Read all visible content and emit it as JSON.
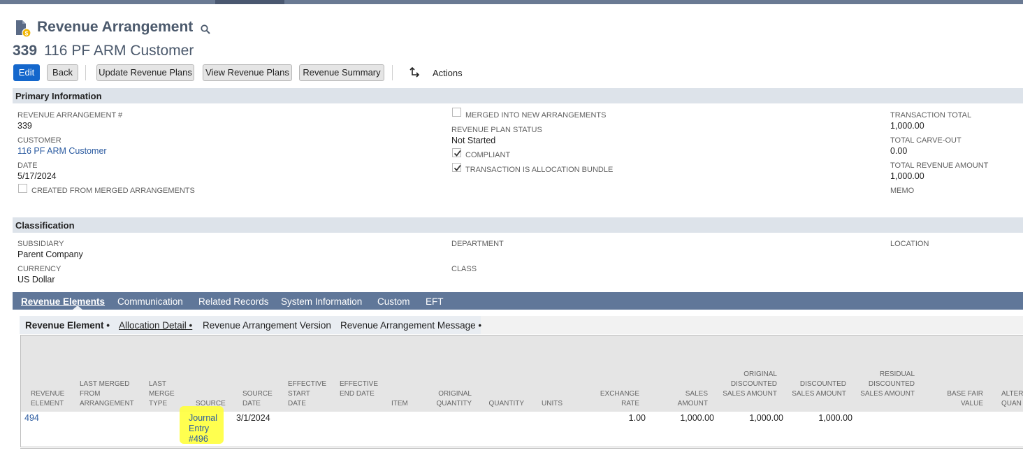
{
  "header": {
    "title": "Revenue Arrangement",
    "record_number": "339",
    "record_name": "116 PF ARM Customer",
    "page_icon": "document-coin-icon",
    "search_icon": "search-icon"
  },
  "toolbar": {
    "edit": "Edit",
    "back": "Back",
    "update_revenue_plans": "Update Revenue Plans",
    "view_revenue_plans": "View Revenue Plans",
    "revenue_summary": "Revenue Summary",
    "actions": "Actions",
    "actions_icon": "actions-arrow-icon"
  },
  "primary": {
    "section_title": "Primary Information",
    "arrangement_label": "REVENUE ARRANGEMENT #",
    "arrangement_value": "339",
    "customer_label": "CUSTOMER",
    "customer_value": "116 PF ARM Customer",
    "date_label": "DATE",
    "date_value": "5/17/2024",
    "created_from_merged_label": "CREATED FROM MERGED ARRANGEMENTS",
    "created_from_merged_checked": false,
    "merged_into_new_label": "MERGED INTO NEW ARRANGEMENTS",
    "merged_into_new_checked": false,
    "plan_status_label": "REVENUE PLAN STATUS",
    "plan_status_value": "Not Started",
    "compliant_label": "COMPLIANT",
    "compliant_checked": true,
    "allocation_bundle_label": "TRANSACTION IS ALLOCATION BUNDLE",
    "allocation_bundle_checked": true,
    "transaction_total_label": "TRANSACTION TOTAL",
    "transaction_total_value": "1,000.00",
    "total_carve_out_label": "TOTAL CARVE-OUT",
    "total_carve_out_value": "0.00",
    "total_revenue_label": "TOTAL REVENUE AMOUNT",
    "total_revenue_value": "1,000.00",
    "memo_label": "MEMO"
  },
  "classification": {
    "section_title": "Classification",
    "subsidiary_label": "SUBSIDIARY",
    "subsidiary_value": "Parent Company",
    "currency_label": "CURRENCY",
    "currency_value": "US Dollar",
    "department_label": "DEPARTMENT",
    "class_label": "CLASS",
    "location_label": "LOCATION"
  },
  "tabs": [
    "Revenue Elements",
    "Communication",
    "Related Records",
    "System Information",
    "Custom",
    "EFT"
  ],
  "subtabs": [
    "Revenue Element •",
    "Allocation Detail •",
    "Revenue Arrangement Version",
    "Revenue Arrangement Message •"
  ],
  "grid": {
    "columns": [
      "REVENUE ELEMENT",
      "LAST MERGED FROM ARRANGEMENT",
      "LAST MERGE TYPE",
      "SOURCE",
      "SOURCE DATE",
      "EFFECTIVE START DATE",
      "EFFECTIVE END DATE",
      "ITEM",
      "ORIGINAL QUANTITY",
      "QUANTITY",
      "UNITS",
      "EXCHANGE RATE",
      "SALES AMOUNT",
      "ORIGINAL DISCOUNTED SALES AMOUNT",
      "DISCOUNTED SALES AMOUNT",
      "RESIDUAL DISCOUNTED SALES AMOUNT",
      "BASE FAIR VALUE",
      "ALTERN QUAN"
    ],
    "row": {
      "revenue_element": "494",
      "source": "Journal Entry #496",
      "source_date": "3/1/2024",
      "exchange_rate": "1.00",
      "sales_amount": "1,000.00",
      "original_discounted_sales_amount": "1,000.00",
      "discounted_sales_amount": "1,000.00"
    },
    "highlight_color": "#ffff3c"
  }
}
